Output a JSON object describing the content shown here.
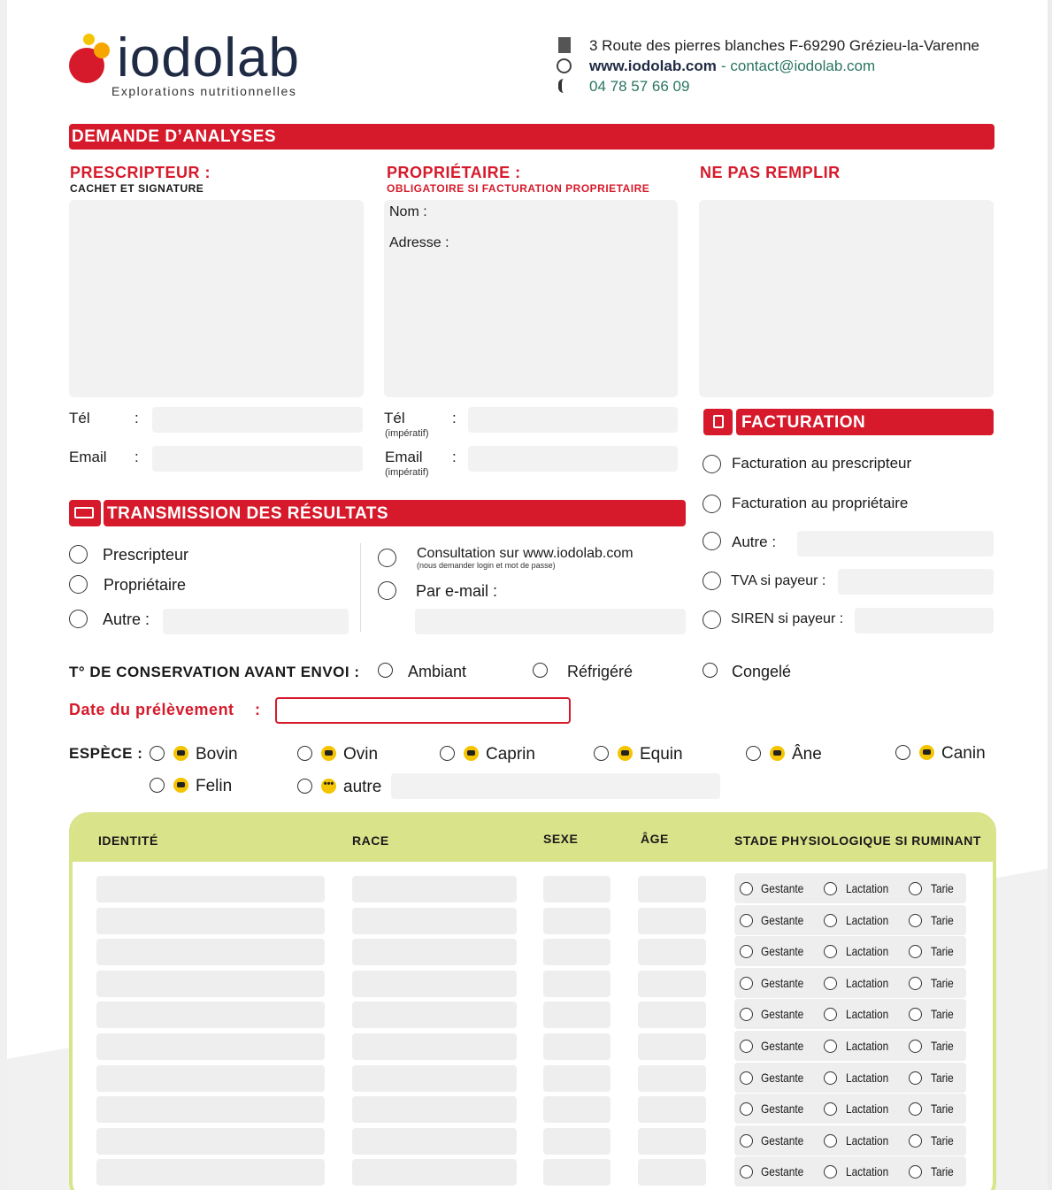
{
  "header": {
    "logo_name": "iodolab",
    "logo_tagline": "Explorations nutritionnelles",
    "address": "3 Route des pierres blanches F-69290 Grézieu-la-Varenne",
    "website": "www.iodolab.com",
    "email_sep": " - contact@iodolab.com",
    "phone": "04 78 57 66 09",
    "icons": [
      "building-icon",
      "globe-icon",
      "phone-icon"
    ]
  },
  "main_title": "DEMANDE D’ANALYSES",
  "prescripteur": {
    "title": "PRESCRIPTEUR :",
    "subtitle": "CACHET ET SIGNATURE",
    "tel_label": "Tél",
    "email_label": "Email",
    "colon": ":"
  },
  "proprietaire": {
    "title": "PROPRIÉTAIRE :",
    "subtitle": "OBLIGATOIRE SI FACTURATION PROPRIETAIRE",
    "nom": "Nom :",
    "adresse": "Adresse :",
    "tel_label": "Tél",
    "email_label": "Email",
    "imperatif": "(impératif)",
    "colon": ":"
  },
  "ne_pas_remplir": "NE PAS REMPLIR",
  "facturation": {
    "title": "FACTURATION",
    "options": [
      "Facturation au prescripteur",
      "Facturation au propriétaire",
      "Autre :",
      "TVA si payeur :",
      "SIREN si payeur :"
    ]
  },
  "transmission": {
    "title": "TRANSMISSION DES RÉSULTATS",
    "left": [
      "Prescripteur",
      "Propriétaire",
      "Autre :"
    ],
    "consultation": "Consultation sur www.iodolab.com",
    "consultation_note": "(nous demander login et mot de passe)",
    "email_option": "Par e-mail :"
  },
  "conservation": {
    "label": "T° DE CONSERVATION AVANT ENVOI :",
    "options": [
      "Ambiant",
      "Réfrigéré",
      "Congelé"
    ]
  },
  "date_label": "Date du prélèvement",
  "date_colon": ":",
  "espece": {
    "label": "ESPÈCE :",
    "row1": [
      "Bovin",
      "Ovin",
      "Caprin",
      "Equin",
      "Âne",
      "Canin"
    ],
    "row2": [
      "Felin",
      "autre"
    ]
  },
  "table": {
    "headers": [
      "IDENTITÉ",
      "RACE",
      "SEXE",
      "ÂGE",
      "STADE PHYSIOLOGIQUE SI RUMINANT"
    ],
    "stade_options": [
      "Gestante",
      "Lactation",
      "Tarie"
    ],
    "row_count": 10
  },
  "colors": {
    "brand_red": "#d61a2b",
    "table_green": "#d9e38a",
    "field_gray": "#f2f2f2",
    "logo_yellow": "#f5c400"
  }
}
